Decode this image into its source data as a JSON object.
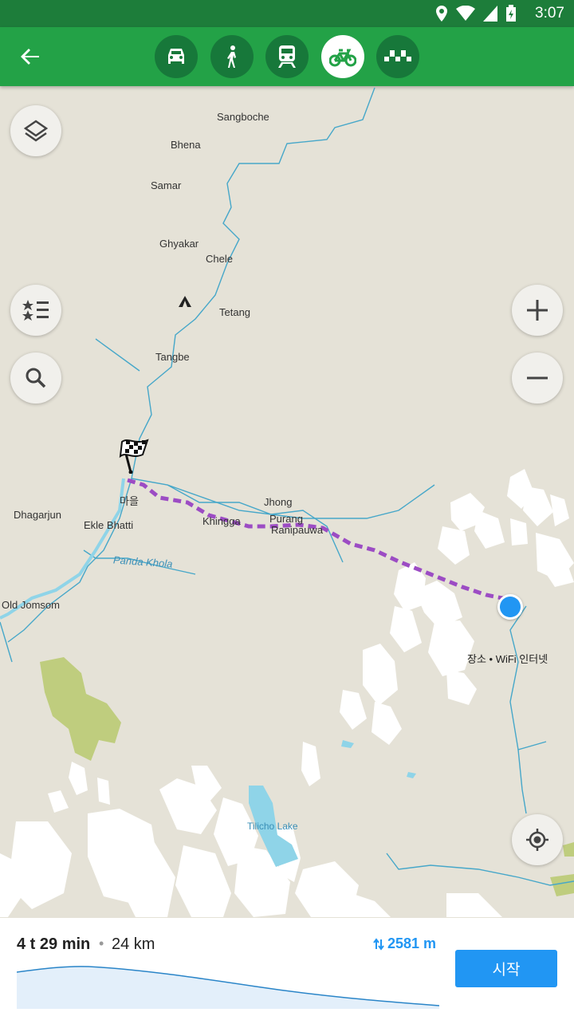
{
  "status": {
    "time": "3:07"
  },
  "toolbar": {
    "modes": [
      {
        "name": "car",
        "active": false
      },
      {
        "name": "walk",
        "active": false
      },
      {
        "name": "transit",
        "active": false
      },
      {
        "name": "bike",
        "active": true
      },
      {
        "name": "taxi",
        "active": false
      }
    ]
  },
  "map": {
    "labels": {
      "sangboche": "Sangboche",
      "bhena": "Bhena",
      "samar": "Samar",
      "ghyakar": "Ghyakar",
      "chele": "Chele",
      "tetang": "Tetang",
      "tangbe": "Tangbe",
      "maeul": "마을",
      "dhagarjun": "Dhagarjun",
      "ekle_bhatti": "Ekle Bhatti",
      "jhong": "Jhong",
      "khingga": "Khingga",
      "purang": "Purang",
      "ranipauwa": "Ranipauwa",
      "panda_khola": "Panda Khola",
      "old_jomsom": "Old Jomsom",
      "current_place": "장소 • WiFi 인터넷",
      "tilicho_lake": "Tilicho Lake"
    }
  },
  "route": {
    "duration": "4 t 29 min",
    "separator": "•",
    "distance": "24 km",
    "elevation": "2581 m",
    "start_label": "시작"
  },
  "colors": {
    "route": "#9c4cc4",
    "accent": "#2196f3",
    "toolbar": "#23a247",
    "statusbar": "#1d7d3a"
  }
}
